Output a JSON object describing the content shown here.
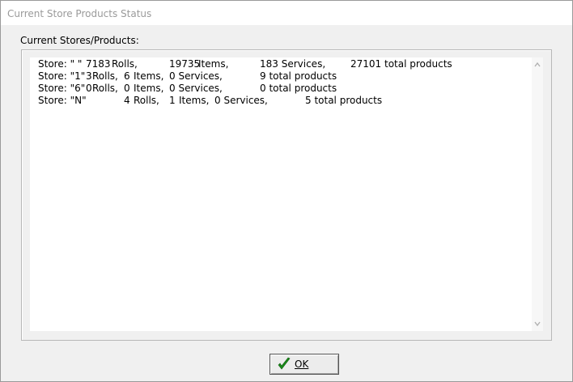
{
  "window": {
    "title": "Current Store Products Status"
  },
  "group": {
    "label": "Current Stores/Products:"
  },
  "rows": [
    [
      "Store: \" \"",
      "7183",
      "Rolls,",
      "19735",
      "Items,",
      "183 Services,",
      "27101 total products"
    ],
    [
      "Store: \"1\"",
      "3",
      "Rolls,",
      "6",
      "Items,",
      "0 Services,",
      "9 total products"
    ],
    [
      "Store: \"6\"",
      "0",
      "Rolls,",
      "0",
      "Items,",
      "0 Services,",
      "0 total products"
    ],
    [
      "Store: \"N\"",
      "4",
      "Rolls,",
      "1",
      "Items,",
      "0 Services,",
      "5 total products"
    ]
  ],
  "scrollbar": {
    "up_icon": "chevron-up-icon",
    "down_icon": "chevron-down-icon"
  },
  "ok_button": {
    "label": "OK",
    "icon": "checkmark-icon",
    "icon_color": "#1a8a1a"
  }
}
